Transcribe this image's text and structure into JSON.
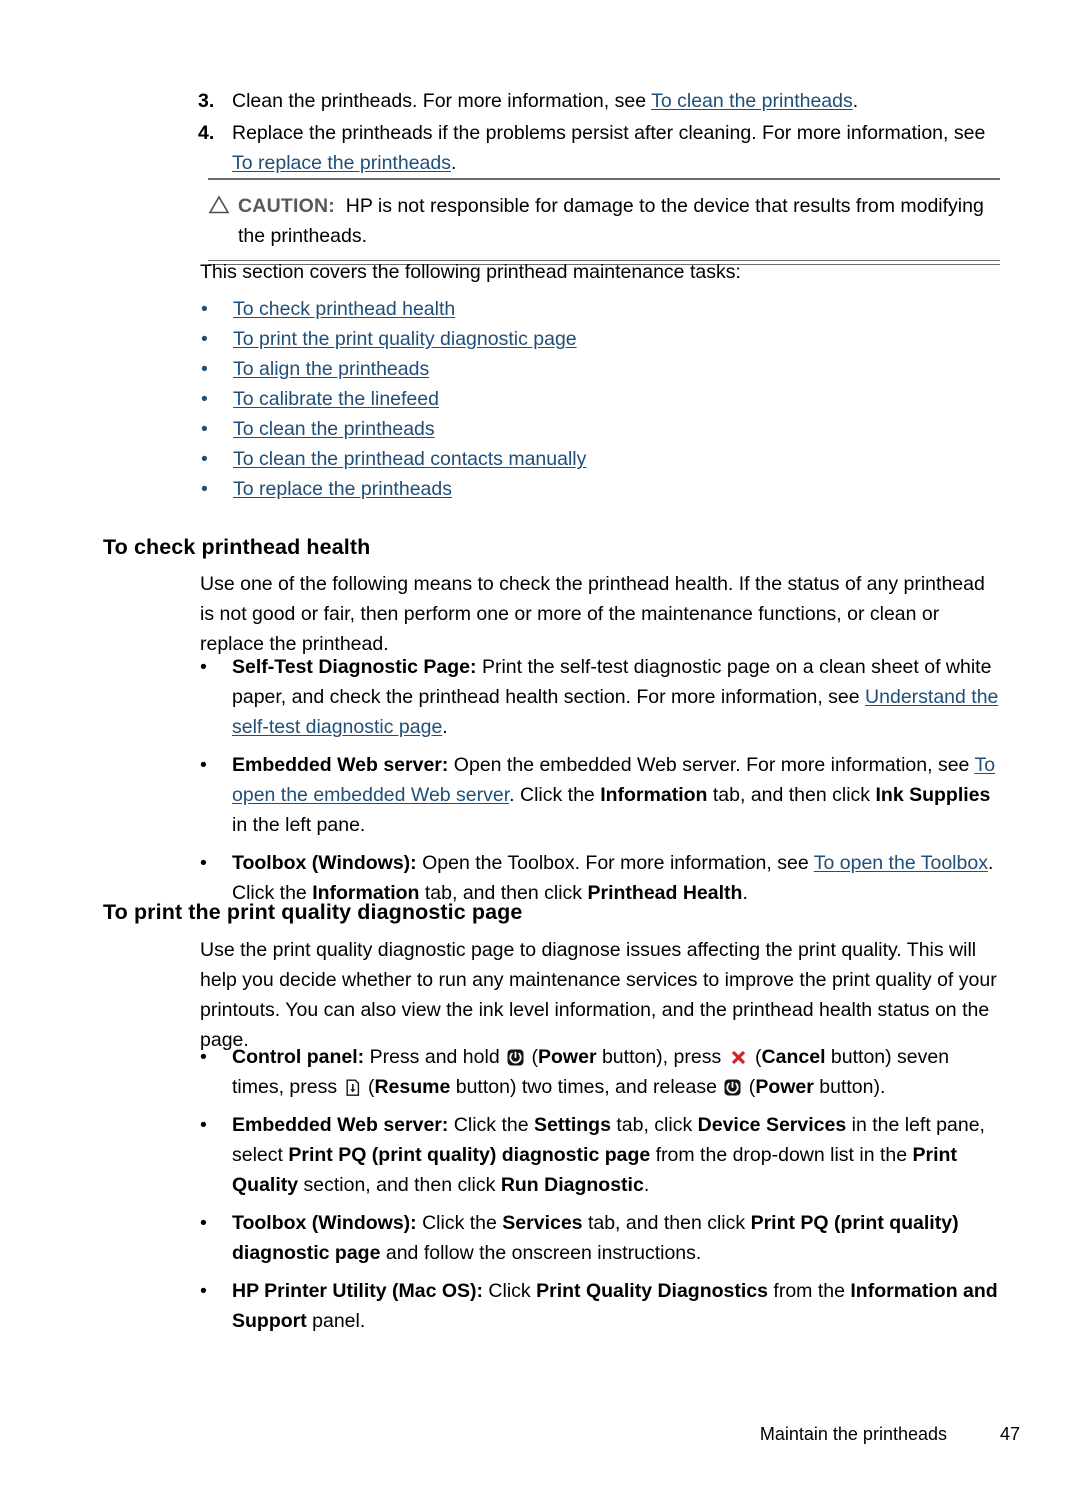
{
  "document": {
    "numbered_list": [
      {
        "number": "3.",
        "text_before": "Clean the printheads. For more information, see ",
        "link": "To clean the printheads",
        "text_after": "."
      },
      {
        "number": "4.",
        "text_before": "Replace the printheads if the problems persist after cleaning. For more information, see ",
        "link": "To replace the printheads",
        "text_after": "."
      }
    ],
    "caution": {
      "icon": "warning-triangle-icon",
      "label": "CAUTION:",
      "text": "HP is not responsible for damage to the device that results from modifying the printheads."
    },
    "intro": "This section covers the following printhead maintenance tasks:",
    "task_links": [
      "To check printhead health",
      "To print the print quality diagnostic page",
      "To align the printheads",
      "To calibrate the linefeed",
      "To clean the printheads",
      "To clean the printhead contacts manually",
      "To replace the printheads"
    ],
    "section_check": {
      "heading": "To check printhead health",
      "paragraph": "Use one of the following means to check the printhead health. If the status of any printhead is not good or fair, then perform one or more of the maintenance functions, or clean or replace the printhead.",
      "bullets": [
        {
          "lead": "Self-Test Diagnostic Page:",
          "part1": " Print the self-test diagnostic page on a clean sheet of white paper, and check the printhead health section. For more information, see ",
          "link": "Understand the self-test diagnostic page",
          "part2": "."
        },
        {
          "lead": "Embedded Web server:",
          "part1": " Open the embedded Web server. For more information, see ",
          "link": "To open the embedded Web server",
          "part2": ". Click the ",
          "bold1": "Information",
          "part3": " tab, and then click ",
          "bold2": "Ink Supplies",
          "part4": " in the left pane."
        },
        {
          "lead": "Toolbox (Windows):",
          "part1": " Open the Toolbox. For more information, see ",
          "link": "To open the Toolbox",
          "part2": ". Click the ",
          "bold1": "Information",
          "part3": " tab, and then click ",
          "bold2": "Printhead Health",
          "part4": "."
        }
      ]
    },
    "section_print": {
      "heading": "To print the print quality diagnostic page",
      "paragraph": "Use the print quality diagnostic page to diagnose issues affecting the print quality. This will help you decide whether to run any maintenance services to improve the print quality of your printouts. You can also view the ink level information, and the printhead health status on the page.",
      "bullet_control": {
        "lead": "Control panel:",
        "t1": " Press and hold ",
        "icon1": "power-button-icon",
        "t2": " (",
        "b1": "Power",
        "t3": " button), press ",
        "icon2": "cancel-button-icon",
        "t4": " (",
        "b2": "Cancel",
        "t5": " button) seven times, press ",
        "icon3": "resume-button-icon",
        "t6": " (",
        "b3": "Resume",
        "t7": " button) two times, and release ",
        "icon4": "power-button-icon",
        "t8": " (",
        "b4": "Power",
        "t9": " button)."
      },
      "bullet_ews": {
        "lead": "Embedded Web server:",
        "t1": " Click the ",
        "b1": "Settings",
        "t2": " tab, click ",
        "b2": "Device Services",
        "t3": " in the left pane, select ",
        "b3": "Print PQ (print quality) diagnostic page",
        "t4": " from the drop-down list in the ",
        "b4": "Print Quality",
        "t5": " section, and then click ",
        "b5": "Run Diagnostic",
        "t6": "."
      },
      "bullet_toolbox": {
        "lead": "Toolbox (Windows):",
        "t1": " Click the ",
        "b1": "Services",
        "t2": " tab, and then click ",
        "b2": "Print PQ (print quality) diagnostic page",
        "t3": " and follow the onscreen instructions."
      },
      "bullet_mac": {
        "lead": "HP Printer Utility (Mac OS):",
        "t1": " Click ",
        "b1": "Print Quality Diagnostics",
        "t2": " from the ",
        "b2": "Information and Support",
        "t3": " panel."
      }
    },
    "footer": {
      "title": "Maintain the printheads",
      "page_number": "47"
    },
    "bullet_glyph": "•",
    "colors": {
      "link": "#1f4e79",
      "rule": "#6b6b6b",
      "caution_label": "#595959",
      "cancel_icon": "#d81e27",
      "text": "#000000"
    }
  }
}
